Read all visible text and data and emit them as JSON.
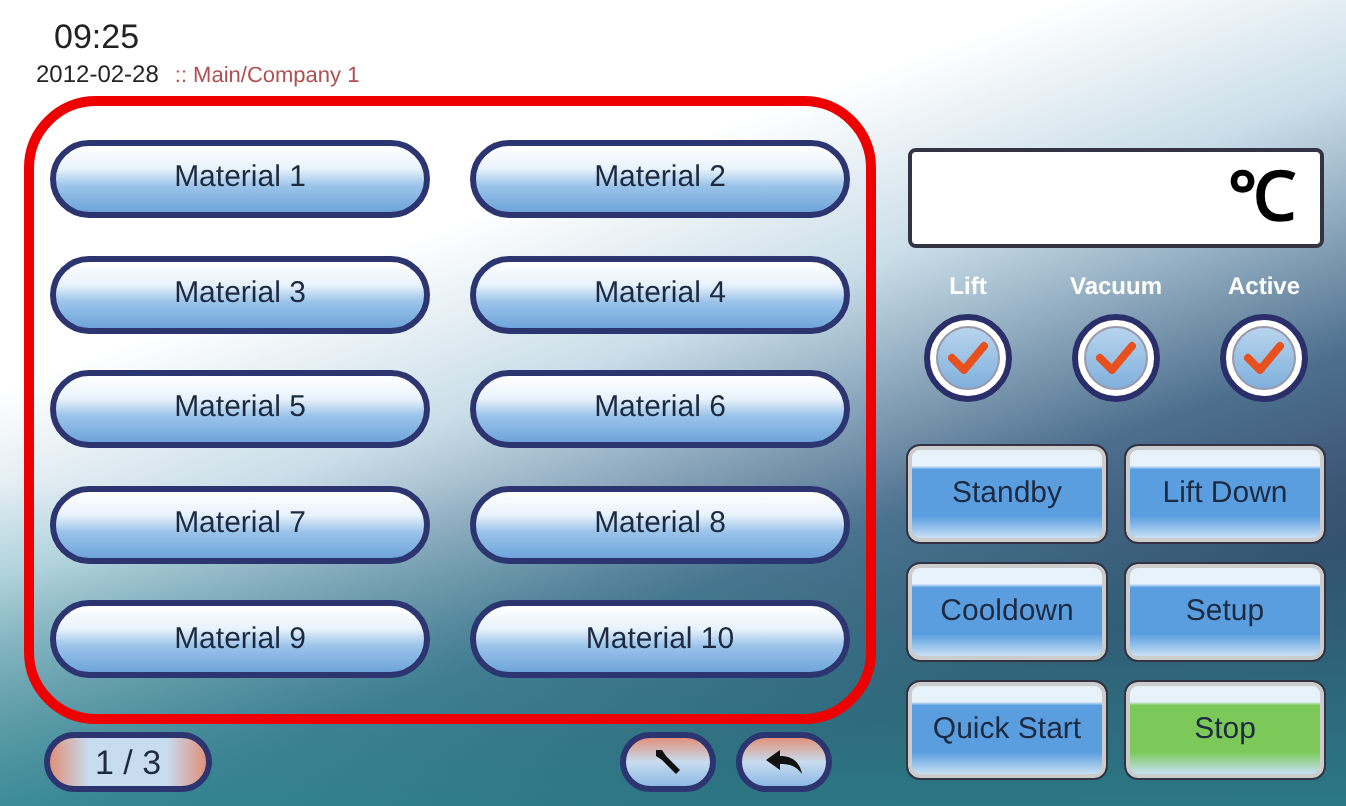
{
  "header": {
    "time": "09:25",
    "date": "2012-02-28",
    "breadcrumb": ":: Main/Company 1"
  },
  "materials": [
    "Material 1",
    "Material 2",
    "Material 3",
    "Material 4",
    "Material 5",
    "Material 6",
    "Material 7",
    "Material 8",
    "Material 9",
    "Material 10"
  ],
  "pager": {
    "page": "1 / 3"
  },
  "display": {
    "unit": "℃"
  },
  "indicators": [
    {
      "label": "Lift",
      "checked": true
    },
    {
      "label": "Vacuum",
      "checked": true
    },
    {
      "label": "Active",
      "checked": true
    }
  ],
  "actions": [
    {
      "label": "Standby",
      "color": "#5a9ee0"
    },
    {
      "label": "Lift Down",
      "color": "#5a9ee0"
    },
    {
      "label": "Cooldown",
      "color": "#5a9ee0"
    },
    {
      "label": "Setup",
      "color": "#5a9ee0"
    },
    {
      "label": "Quick Start",
      "color": "#5a9ee0"
    },
    {
      "label": "Stop",
      "color": "#7cc95a"
    }
  ]
}
